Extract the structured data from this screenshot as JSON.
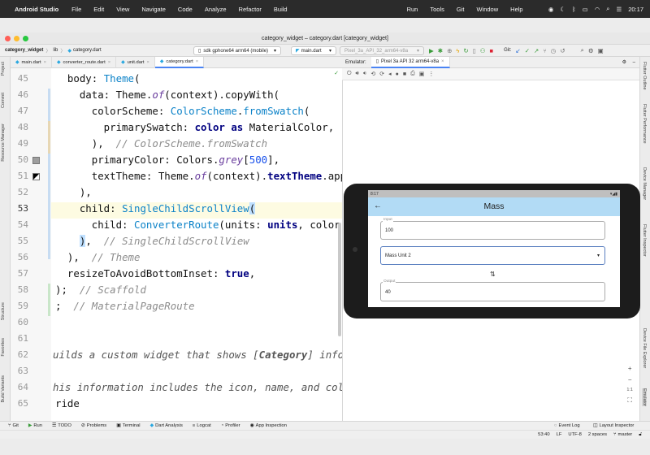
{
  "menubar": {
    "app": "Android Studio",
    "items": [
      "File",
      "Edit",
      "View",
      "Navigate",
      "Code",
      "Analyze",
      "Refactor",
      "Build",
      "Run",
      "Tools",
      "Git",
      "Window",
      "Help"
    ],
    "clock": "20:17"
  },
  "window": {
    "title": "category_widget – category.dart [category_widget]"
  },
  "breadcrumb": {
    "project": "category_widget",
    "dir": "lib",
    "file": "category.dart"
  },
  "toolbar": {
    "device": "sdk gphone64 arm64 (mobile)",
    "config": "main.dart",
    "avd": "Pixel_3a_API_32_arm64-v8a",
    "git_label": "Git:"
  },
  "tabs": [
    {
      "label": "main.dart"
    },
    {
      "label": "converter_route.dart"
    },
    {
      "label": "unit.dart"
    },
    {
      "label": "category.dart"
    }
  ],
  "left_tools": [
    "Project",
    "Commit",
    "Resource Manager",
    "Structure",
    "Favorites",
    "Build Variants"
  ],
  "right_tools": [
    "Flutter Outline",
    "Flutter Performance",
    "Device Manager",
    "Flutter Inspector",
    "Device File Explorer",
    "Emulator"
  ],
  "line_numbers": [
    "45",
    "46",
    "47",
    "48",
    "49",
    "50",
    "51",
    "52",
    "53",
    "54",
    "55",
    "56",
    "57",
    "58",
    "59",
    "60",
    "61",
    "62",
    "63",
    "64",
    "65"
  ],
  "emulator": {
    "label": "Emulator:",
    "device_tab": "Pixel 3a API 32 arm64-v8a",
    "phone_time": "8:17",
    "app_title": "Mass",
    "input_label": "Input",
    "input_value": "100",
    "unit_value": "Mass Unit 2",
    "output_label": "Output",
    "output_value": "40",
    "zoom_plus": "+",
    "zoom_one": "1:1"
  },
  "bottom_tools": [
    "Git",
    "Run",
    "TODO",
    "Problems",
    "Terminal",
    "Dart Analysis",
    "Logcat",
    "Profiler",
    "App Inspection"
  ],
  "bottom_right": [
    "Event Log",
    "Layout Inspector"
  ],
  "status": {
    "position": "53:40",
    "line_sep": "LF",
    "encoding": "UTF-8",
    "indent": "2 spaces",
    "branch": "master"
  }
}
